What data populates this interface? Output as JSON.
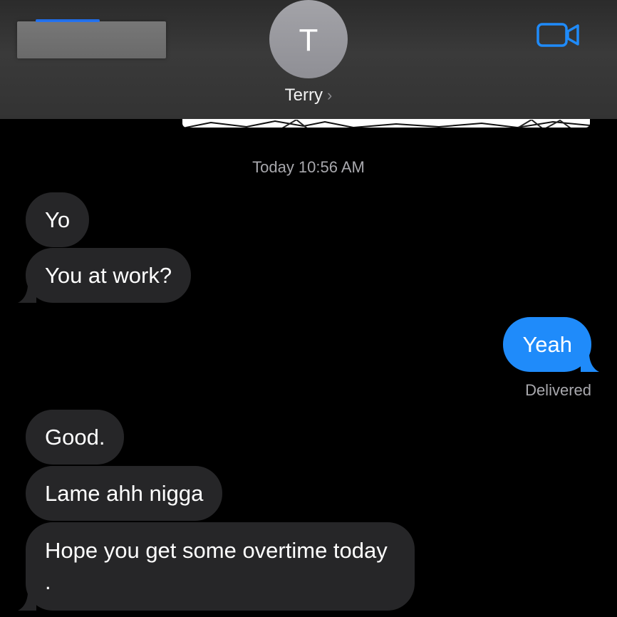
{
  "header": {
    "avatar_initial": "T",
    "contact_name": "Terry",
    "chevron": "›",
    "back_button_redacted": true,
    "video_call_icon": "video-camera-icon",
    "accent_color": "#1f8bfa"
  },
  "conversation": {
    "timestamp": "Today 10:56 AM",
    "messages": [
      {
        "direction": "received",
        "text": "Yo"
      },
      {
        "direction": "received",
        "text": "You at work?"
      },
      {
        "direction": "sent",
        "text": "Yeah"
      },
      {
        "direction": "received",
        "text": "Good."
      },
      {
        "direction": "received",
        "text": "Lame ahh nigga"
      },
      {
        "direction": "received",
        "text": "Hope you get some overtime today ."
      }
    ],
    "delivery_status": "Delivered"
  },
  "colors": {
    "received_bubble": "#262628",
    "sent_bubble": "#1f8bfa",
    "background": "#000000"
  }
}
